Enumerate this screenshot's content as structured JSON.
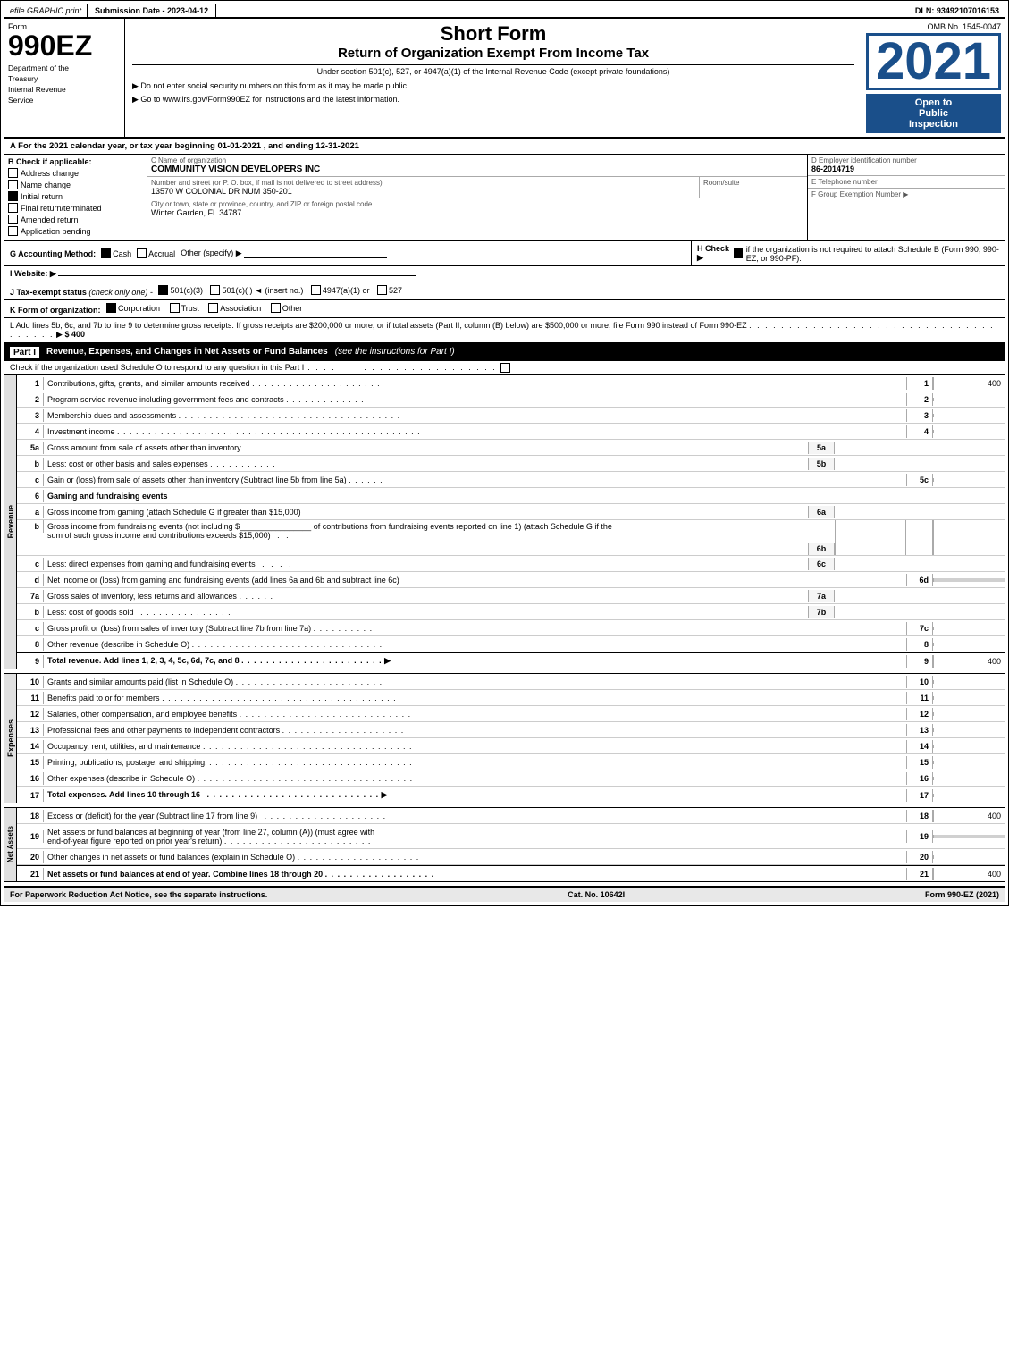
{
  "topbar": {
    "efile": "efile GRAPHIC print",
    "submission_label": "Submission Date - 2023-04-12",
    "dln_label": "DLN: 93492107016153"
  },
  "header": {
    "form_label": "Form",
    "form_number": "990EZ",
    "title1": "Short Form",
    "title2": "Return of Organization Exempt From Income Tax",
    "subtitle": "Under section 501(c), 527, or 4947(a)(1) of the Internal Revenue Code (except private foundations)",
    "bullet1": "▶ Do not enter social security numbers on this form as it may be made public.",
    "bullet2": "▶ Go to www.irs.gov/Form990EZ for instructions and the latest information.",
    "year": "2021",
    "omb": "OMB No. 1545-0047",
    "open_label1": "Open to",
    "open_label2": "Public",
    "open_label3": "Inspection",
    "dept_line1": "Department of the",
    "dept_line2": "Treasury",
    "dept_line3": "Internal Revenue",
    "dept_line4": "Service"
  },
  "section_a": {
    "text": "A  For the 2021 calendar year, or tax year beginning 01-01-2021 , and ending 12-31-2021"
  },
  "section_b": {
    "label": "B  Check if applicable:",
    "checks": {
      "address_change": "Address change",
      "name_change": "Name change",
      "initial_return": "Initial return",
      "final_return": "Final return/terminated",
      "amended_return": "Amended return",
      "application_pending": "Application pending"
    },
    "checked": [
      "initial_return"
    ]
  },
  "section_c": {
    "label": "C Name of organization",
    "org_name": "COMMUNITY VISION DEVELOPERS INC",
    "street_label": "Number and street (or P. O. box, if mail is not delivered to street address)",
    "street_value": "13570 W COLONIAL DR NUM 350-201",
    "room_label": "Room/suite",
    "room_value": "",
    "city_label": "City or town, state or province, country, and ZIP or foreign postal code",
    "city_value": "Winter Garden, FL  34787"
  },
  "section_d": {
    "label": "D Employer identification number",
    "ein": "86-2014719",
    "phone_label": "E Telephone number",
    "phone_value": "",
    "group_label": "F Group Exemption Number",
    "group_arrow": "▶"
  },
  "section_g": {
    "label": "G Accounting Method:",
    "cash_label": "Cash",
    "cash_checked": true,
    "accrual_label": "Accrual",
    "accrual_checked": false,
    "other_label": "Other (specify) ▶",
    "other_line": "___________________________"
  },
  "section_h": {
    "label": "H  Check ▶",
    "checked": true,
    "text": "if the organization is not required to attach Schedule B (Form 990, 990-EZ, or 990-PF)."
  },
  "section_i": {
    "label": "I  Website: ▶",
    "value": ""
  },
  "section_j": {
    "label": "J Tax-exempt status",
    "note": "(check only one)",
    "options": [
      "501(c)(3)",
      "501(c)(  )  ◄ (insert no.)",
      "4947(a)(1) or",
      "527"
    ],
    "checked": "501(c)(3)"
  },
  "section_k": {
    "label": "K  Form of organization:",
    "options": [
      "Corporation",
      "Trust",
      "Association",
      "Other"
    ],
    "checked": "Corporation"
  },
  "section_l": {
    "text": "L  Add lines 5b, 6c, and 7b to line 9 to determine gross receipts. If gross receipts are $200,000 or more, or if total assets (Part II, column (B) below) are $500,000 or more, file Form 990 instead of Form 990-EZ",
    "dots": ". . . . . . . . . . . . . . . . . . . . . . . . . . . . . . . . . . . . .",
    "arrow": "▶",
    "amount": "$ 400"
  },
  "part1": {
    "label": "Part I",
    "title": "Revenue, Expenses, and Changes in Net Assets or Fund Balances",
    "note": "(see the instructions for Part I)",
    "check_note": "Check if the organization used Schedule O to respond to any question in this Part I",
    "check_dots": ". . . . . . . . . . . . . . . . . . . . . . . .",
    "check_box": "□",
    "lines": [
      {
        "num": "1",
        "desc": "Contributions, gifts, grants, and similar amounts received",
        "dots": ". . . . . . . . . . . . . . . . . . . . .",
        "ref": "1",
        "amount": "400"
      },
      {
        "num": "2",
        "desc": "Program service revenue including government fees and contracts",
        "dots": ". . . . . . . . . . . . .",
        "ref": "2",
        "amount": ""
      },
      {
        "num": "3",
        "desc": "Membership dues and assessments",
        "dots": ". . . . . . . . . . . . . . . . . . . . . . . . . . . . . . . . . . . .",
        "ref": "3",
        "amount": ""
      },
      {
        "num": "4",
        "desc": "Investment income",
        "dots": ". . . . . . . . . . . . . . . . . . . . . . . . . . . . . . . . . . . . . . . . . . . . . . . . .",
        "ref": "4",
        "amount": ""
      },
      {
        "num": "5a",
        "desc": "Gross amount from sale of assets other than inventory",
        "dots": ". . . . . . .",
        "sub_code": "5a",
        "ref": "",
        "amount": ""
      },
      {
        "num": "b",
        "desc": "Less: cost or other basis and sales expenses",
        "dots": ". . . . . . . . . . .",
        "sub_code": "5b",
        "ref": "",
        "amount": ""
      },
      {
        "num": "c",
        "desc": "Gain or (loss) from sale of assets other than inventory (Subtract line 5b from line 5a)",
        "dots": ". . . . . .",
        "ref": "5c",
        "amount": ""
      },
      {
        "num": "6",
        "desc": "Gaming and fundraising events",
        "ref": "",
        "amount": ""
      },
      {
        "num": "a",
        "desc": "Gross income from gaming (attach Schedule G if greater than $15,000)",
        "sub_code": "6a",
        "ref": "",
        "amount": ""
      },
      {
        "num": "b",
        "desc": "Gross income from fundraising events (not including $___________  of contributions from fundraising events reported on line 1) (attach Schedule G if the sum of such gross income and contributions exceeds $15,000)",
        "dots": ". .",
        "sub_code": "6b",
        "ref": "",
        "amount": ""
      },
      {
        "num": "c",
        "desc": "Less: direct expenses from gaming and fundraising events",
        "dots": ". . . .",
        "sub_code": "6c",
        "ref": "",
        "amount": ""
      },
      {
        "num": "d",
        "desc": "Net income or (loss) from gaming and fundraising events (add lines 6a and 6b and subtract line 6c)",
        "ref": "6d",
        "amount": ""
      },
      {
        "num": "7a",
        "desc": "Gross sales of inventory, less returns and allowances",
        "dots": ". . . . . .",
        "sub_code": "7a",
        "ref": "",
        "amount": ""
      },
      {
        "num": "b",
        "desc": "Less: cost of goods sold",
        "dots": ". . . . . . . . . . . . . . .",
        "sub_code": "7b",
        "ref": "",
        "amount": ""
      },
      {
        "num": "c",
        "desc": "Gross profit or (loss) from sales of inventory (Subtract line 7b from line 7a)",
        "dots": ". . . . . . . . . .",
        "ref": "7c",
        "amount": ""
      },
      {
        "num": "8",
        "desc": "Other revenue (describe in Schedule O)",
        "dots": ". . . . . . . . . . . . . . . . . . . . . . . . . . . . . . . .",
        "ref": "8",
        "amount": ""
      },
      {
        "num": "9",
        "desc": "Total revenue. Add lines 1, 2, 3, 4, 5c, 6d, 7c, and 8",
        "dots": ". . . . . . . . . . . . . . . . . . . . . . .",
        "arrow": "▶",
        "ref": "9",
        "amount": "400",
        "bold": true
      }
    ]
  },
  "expenses": {
    "lines": [
      {
        "num": "10",
        "desc": "Grants and similar amounts paid (list in Schedule O)",
        "dots": ". . . . . . . . . . . . . . . . . . . . . . . .",
        "ref": "10",
        "amount": ""
      },
      {
        "num": "11",
        "desc": "Benefits paid to or for members",
        "dots": ". . . . . . . . . . . . . . . . . . . . . . . . . . . . . . . . . . . . . .",
        "ref": "11",
        "amount": ""
      },
      {
        "num": "12",
        "desc": "Salaries, other compensation, and employee benefits",
        "dots": ". . . . . . . . . . . . . . . . . . . . . . . . . . . .",
        "ref": "12",
        "amount": ""
      },
      {
        "num": "13",
        "desc": "Professional fees and other payments to independent contractors",
        "dots": ". . . . . . . . . . . . . . . . . . . .",
        "ref": "13",
        "amount": ""
      },
      {
        "num": "14",
        "desc": "Occupancy, rent, utilities, and maintenance",
        "dots": ". . . . . . . . . . . . . . . . . . . . . . . . . . . . . . . . . .",
        "ref": "14",
        "amount": ""
      },
      {
        "num": "15",
        "desc": "Printing, publications, postage, and shipping.",
        "dots": ". . . . . . . . . . . . . . . . . . . . . . . . . . . . . . . . .",
        "ref": "15",
        "amount": ""
      },
      {
        "num": "16",
        "desc": "Other expenses (describe in Schedule O)",
        "dots": ". . . . . . . . . . . . . . . . . . . . . . . . . . . . . . . . . . .",
        "ref": "16",
        "amount": ""
      },
      {
        "num": "17",
        "desc": "Total expenses. Add lines 10 through 16",
        "dots": ". . . . . . . . . . . . . . . . . . . . . . . . . . . . .",
        "arrow": "▶",
        "ref": "17",
        "amount": "",
        "bold": true
      }
    ]
  },
  "net_assets": {
    "lines": [
      {
        "num": "18",
        "desc": "Excess or (deficit) for the year (Subtract line 17 from line 9)",
        "dots": ". . . . . . . . . . . . . . . . . . . .",
        "ref": "18",
        "amount": "400"
      },
      {
        "num": "19",
        "desc": "Net assets or fund balances at beginning of year (from line 27, column (A)) (must agree with end-of-year figure reported on prior year's return)",
        "dots": ". . . . . . . . . . . . . . . . . . . . . . . .",
        "ref": "19",
        "amount": ""
      },
      {
        "num": "20",
        "desc": "Other changes in net assets or fund balances (explain in Schedule O)",
        "dots": ". . . . . . . . . . . . . . . . . . . .",
        "ref": "20",
        "amount": ""
      },
      {
        "num": "21",
        "desc": "Net assets or fund balances at end of year. Combine lines 18 through 20",
        "dots": ". . . . . . . . . . . . . . . . . .",
        "ref": "21",
        "amount": "400",
        "bold": true
      }
    ]
  },
  "footer": {
    "left": "For Paperwork Reduction Act Notice, see the separate instructions.",
    "cat": "Cat. No. 10642I",
    "right": "Form 990-EZ (2021)"
  }
}
